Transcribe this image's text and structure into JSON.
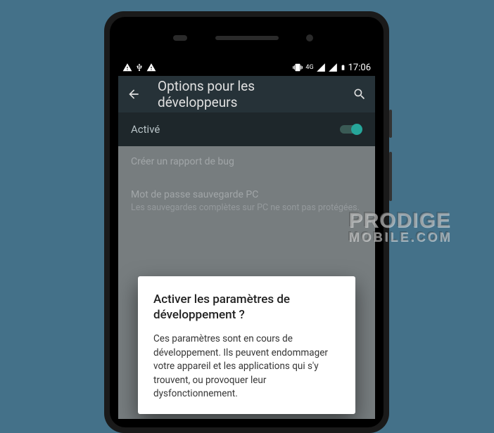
{
  "statusbar": {
    "time": "17:06",
    "network_label": "4G"
  },
  "appbar": {
    "title": "Options pour les développeurs"
  },
  "master_toggle": {
    "label": "Activé"
  },
  "settings": {
    "bug_report": {
      "title": "Créer un rapport de bug"
    },
    "backup_pw": {
      "title": "Mot de passe sauvegarde PC",
      "subtitle": "Les sauvegardes complètes sur PC ne sont pas protégées."
    }
  },
  "dialog": {
    "title": "Activer les paramètres de développement ?",
    "body": "Ces paramètres sont en cours de développement. Ils peuvent endommager votre appareil et les applications qui s'y trouvent, ou provoquer leur dysfonctionnement."
  },
  "watermark": {
    "line1": "PRODIGE",
    "line2": "MOBILE.COM"
  }
}
